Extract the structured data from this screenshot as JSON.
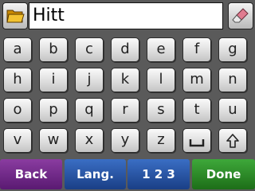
{
  "input": {
    "value": "Hitt"
  },
  "icons": {
    "folder": "folder-icon",
    "eraser": "eraser-icon",
    "space": "space-icon",
    "shift": "shift-arrow-icon"
  },
  "keys": {
    "row1": [
      "a",
      "b",
      "c",
      "d",
      "e",
      "f",
      "g"
    ],
    "row2": [
      "h",
      "i",
      "j",
      "k",
      "l",
      "m",
      "n"
    ],
    "row3": [
      "o",
      "p",
      "q",
      "r",
      "s",
      "t",
      "u"
    ],
    "row4": [
      "v",
      "w",
      "x",
      "y",
      "z"
    ]
  },
  "bottom": {
    "back": "Back",
    "lang": "Lang.",
    "numbers": "1 2 3",
    "done": "Done"
  },
  "colors": {
    "back": "#6e2a88",
    "lang": "#2a56a6",
    "numbers": "#2a56a6",
    "done": "#2d8a28"
  }
}
